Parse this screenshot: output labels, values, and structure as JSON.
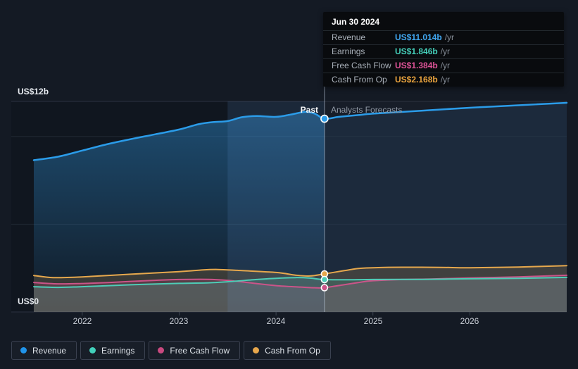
{
  "tooltip": {
    "date": "Jun 30 2024",
    "rows": [
      {
        "label": "Revenue",
        "value": "US$11.014b",
        "suffix": "/yr",
        "color": "#41a7f1"
      },
      {
        "label": "Earnings",
        "value": "US$1.846b",
        "suffix": "/yr",
        "color": "#45cfba"
      },
      {
        "label": "Free Cash Flow",
        "value": "US$1.384b",
        "suffix": "/yr",
        "color": "#dd5397"
      },
      {
        "label": "Cash From Op",
        "value": "US$2.168b",
        "suffix": "/yr",
        "color": "#eaa43e"
      }
    ]
  },
  "axis": {
    "y_top_label": "US$12b",
    "y_bottom_label": "US$0",
    "x_labels": [
      "2022",
      "2023",
      "2024",
      "2025",
      "2026"
    ]
  },
  "phases": {
    "past_label": "Past",
    "forecast_label": "Analysts Forecasts"
  },
  "legend": [
    {
      "label": "Revenue",
      "color": "#2094ea"
    },
    {
      "label": "Earnings",
      "color": "#42d0bb"
    },
    {
      "label": "Free Cash Flow",
      "color": "#c9497f"
    },
    {
      "label": "Cash From Op",
      "color": "#e8a74c"
    }
  ],
  "chart_data": {
    "type": "line",
    "unit": "US$ billions per year",
    "x_domain": [
      2021.5,
      2027.0
    ],
    "ylim": [
      0,
      12
    ],
    "y_gridlines": [
      12,
      10,
      5,
      0
    ],
    "x_ticks": [
      2022,
      2023,
      2024,
      2025,
      2026
    ],
    "past_until": 2024.5,
    "highlight_band": [
      2023.5,
      2024.5
    ],
    "marker_date": "Jun 30 2024",
    "series": [
      {
        "name": "Revenue",
        "color": "#2b9ce9",
        "marker_value": 11.014,
        "points": [
          [
            2021.5,
            8.65
          ],
          [
            2021.75,
            8.85
          ],
          [
            2022,
            9.2
          ],
          [
            2022.25,
            9.55
          ],
          [
            2022.5,
            9.85
          ],
          [
            2022.75,
            10.12
          ],
          [
            2023,
            10.4
          ],
          [
            2023.2,
            10.7
          ],
          [
            2023.35,
            10.82
          ],
          [
            2023.5,
            10.88
          ],
          [
            2023.65,
            11.1
          ],
          [
            2023.8,
            11.17
          ],
          [
            2024,
            11.12
          ],
          [
            2024.15,
            11.25
          ],
          [
            2024.3,
            11.4
          ],
          [
            2024.4,
            11.3
          ],
          [
            2024.5,
            11.014
          ],
          [
            2024.65,
            11.12
          ],
          [
            2024.85,
            11.22
          ],
          [
            2025,
            11.3
          ],
          [
            2025.5,
            11.47
          ],
          [
            2026,
            11.64
          ],
          [
            2026.5,
            11.78
          ],
          [
            2027,
            11.92
          ]
        ]
      },
      {
        "name": "Cash From Op",
        "color": "#e6a84d",
        "marker_value": 2.168,
        "points": [
          [
            2021.5,
            2.08
          ],
          [
            2021.7,
            1.96
          ],
          [
            2022,
            2.0
          ],
          [
            2022.5,
            2.15
          ],
          [
            2023,
            2.3
          ],
          [
            2023.25,
            2.4
          ],
          [
            2023.4,
            2.42
          ],
          [
            2023.6,
            2.37
          ],
          [
            2024,
            2.25
          ],
          [
            2024.2,
            2.1
          ],
          [
            2024.35,
            2.05
          ],
          [
            2024.5,
            2.168
          ],
          [
            2024.7,
            2.35
          ],
          [
            2024.85,
            2.48
          ],
          [
            2025,
            2.52
          ],
          [
            2025.3,
            2.55
          ],
          [
            2025.7,
            2.54
          ],
          [
            2026,
            2.52
          ],
          [
            2026.5,
            2.56
          ],
          [
            2027,
            2.64
          ]
        ]
      },
      {
        "name": "Free Cash Flow",
        "color": "#cb5489",
        "marker_value": 1.384,
        "points": [
          [
            2021.5,
            1.68
          ],
          [
            2021.75,
            1.6
          ],
          [
            2022,
            1.62
          ],
          [
            2022.25,
            1.67
          ],
          [
            2022.5,
            1.74
          ],
          [
            2022.75,
            1.8
          ],
          [
            2023,
            1.85
          ],
          [
            2023.3,
            1.86
          ],
          [
            2023.5,
            1.8
          ],
          [
            2023.7,
            1.68
          ],
          [
            2024,
            1.5
          ],
          [
            2024.25,
            1.42
          ],
          [
            2024.4,
            1.38
          ],
          [
            2024.5,
            1.384
          ],
          [
            2024.7,
            1.55
          ],
          [
            2024.9,
            1.72
          ],
          [
            2025,
            1.78
          ],
          [
            2025.3,
            1.85
          ],
          [
            2025.6,
            1.88
          ],
          [
            2026,
            1.94
          ],
          [
            2026.5,
            2.0
          ],
          [
            2027,
            2.09
          ]
        ]
      },
      {
        "name": "Earnings",
        "color": "#4ecdb7",
        "marker_value": 1.846,
        "points": [
          [
            2021.5,
            1.44
          ],
          [
            2021.75,
            1.4
          ],
          [
            2022,
            1.44
          ],
          [
            2022.5,
            1.55
          ],
          [
            2023,
            1.63
          ],
          [
            2023.3,
            1.66
          ],
          [
            2023.5,
            1.72
          ],
          [
            2023.8,
            1.85
          ],
          [
            2024,
            1.92
          ],
          [
            2024.2,
            1.96
          ],
          [
            2024.35,
            1.93
          ],
          [
            2024.5,
            1.846
          ],
          [
            2024.8,
            1.84
          ],
          [
            2025,
            1.85
          ],
          [
            2025.5,
            1.86
          ],
          [
            2026,
            1.89
          ],
          [
            2026.5,
            1.92
          ],
          [
            2027,
            1.97
          ]
        ]
      }
    ]
  }
}
